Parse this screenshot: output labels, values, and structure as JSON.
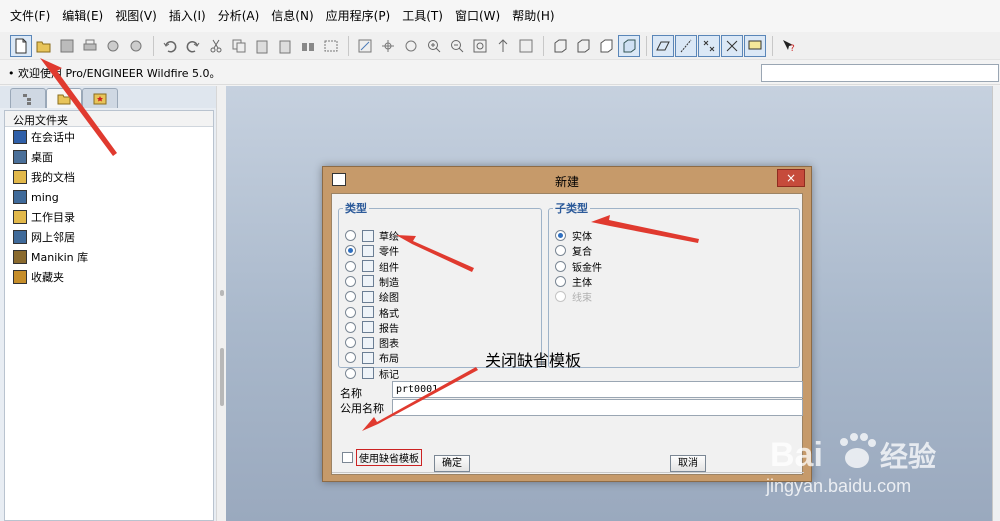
{
  "menu": [
    "文件(F)",
    "编辑(E)",
    "视图(V)",
    "插入(I)",
    "分析(A)",
    "信息(N)",
    "应用程序(P)",
    "工具(T)",
    "窗口(W)",
    "帮助(H)"
  ],
  "message": "• 欢迎使用 Pro/ENGINEER Wildfire 5.0。",
  "navigator": {
    "header": "公用文件夹",
    "items": [
      {
        "label": "在会话中",
        "icon": "monitor-icon"
      },
      {
        "label": "桌面",
        "icon": "desktop-icon"
      },
      {
        "label": "我的文档",
        "icon": "folder-icon"
      },
      {
        "label": "ming",
        "icon": "computer-icon"
      },
      {
        "label": "工作目录",
        "icon": "folder-star-icon"
      },
      {
        "label": "网上邻居",
        "icon": "network-icon"
      },
      {
        "label": "Manikin 库",
        "icon": "library-icon"
      },
      {
        "label": "收藏夹",
        "icon": "favorites-icon"
      }
    ]
  },
  "dialog": {
    "title": "新建",
    "close_label": "×",
    "type_legend": "类型",
    "types": [
      {
        "label": "草绘",
        "checked": false
      },
      {
        "label": "零件",
        "checked": true
      },
      {
        "label": "组件",
        "checked": false
      },
      {
        "label": "制造",
        "checked": false
      },
      {
        "label": "绘图",
        "checked": false
      },
      {
        "label": "格式",
        "checked": false
      },
      {
        "label": "报告",
        "checked": false
      },
      {
        "label": "图表",
        "checked": false
      },
      {
        "label": "布局",
        "checked": false
      },
      {
        "label": "标记",
        "checked": false
      }
    ],
    "subtype_legend": "子类型",
    "subtypes": [
      {
        "label": "实体",
        "checked": true,
        "disabled": false
      },
      {
        "label": "复合",
        "checked": false,
        "disabled": false
      },
      {
        "label": "钣金件",
        "checked": false,
        "disabled": false
      },
      {
        "label": "主体",
        "checked": false,
        "disabled": false
      },
      {
        "label": "线束",
        "checked": false,
        "disabled": true
      }
    ],
    "name_label": "名称",
    "name_value": "prt0001",
    "common_name_label": "公用名称",
    "common_name_value": "",
    "default_template_label": "使用缺省模板",
    "default_template_checked": false,
    "ok_label": "确定",
    "cancel_label": "取消"
  },
  "annotation": "关闭缺省模板",
  "watermark": {
    "brand": "Bai",
    "brand_cn": "经验",
    "url": "jingyan.baidu.com"
  }
}
